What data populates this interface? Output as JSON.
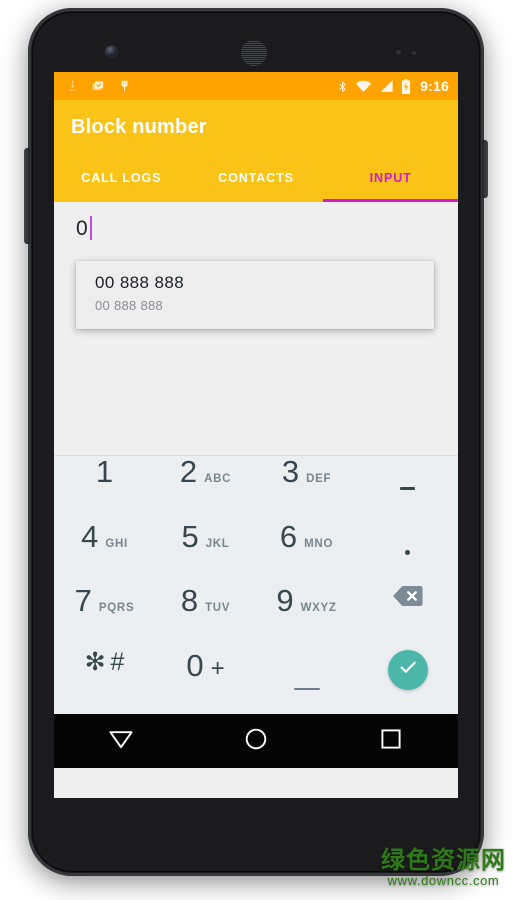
{
  "status_bar": {
    "clock": "9:16",
    "left_icons": [
      "usb-download-icon",
      "screenshot-saved-icon",
      "android-debug-icon"
    ],
    "right_icons": [
      "bluetooth-icon",
      "wifi-icon",
      "cellular-signal-icon",
      "battery-charging-icon"
    ],
    "background_color": "#FFA300"
  },
  "app_bar": {
    "title": "Block number",
    "background_color": "#F9C318",
    "title_color": "#FFFFFF"
  },
  "tabs": {
    "items": [
      {
        "label": "CALL LOGS",
        "selected": false
      },
      {
        "label": "CONTACTS",
        "selected": false
      },
      {
        "label": "INPUT",
        "selected": true
      }
    ],
    "indicator_color": "#D21AD2",
    "selected_text_color": "#D21AD2"
  },
  "input_area": {
    "value": "0",
    "cursor_color": "#C148E0",
    "background_color": "#EFEFEF"
  },
  "suggestions": {
    "items": [
      {
        "primary": "00 888 888",
        "secondary": "00 888 888"
      }
    ],
    "background_color": "#EEEEEE"
  },
  "keypad": {
    "background_color": "#ECEFF1",
    "keys": [
      {
        "digit": "1",
        "letters": "",
        "type": "digit"
      },
      {
        "digit": "2",
        "letters": "ABC",
        "type": "digit"
      },
      {
        "digit": "3",
        "letters": "DEF",
        "type": "digit"
      },
      {
        "digit": "",
        "letters": "",
        "type": "dash",
        "name": "dash-key"
      },
      {
        "digit": "4",
        "letters": "GHI",
        "type": "digit"
      },
      {
        "digit": "5",
        "letters": "JKL",
        "type": "digit"
      },
      {
        "digit": "6",
        "letters": "MNO",
        "type": "digit"
      },
      {
        "digit": "",
        "letters": "",
        "type": "dot",
        "name": "dot-key"
      },
      {
        "digit": "7",
        "letters": "PQRS",
        "type": "digit"
      },
      {
        "digit": "8",
        "letters": "TUV",
        "type": "digit"
      },
      {
        "digit": "9",
        "letters": "WXYZ",
        "type": "digit"
      },
      {
        "digit": "",
        "letters": "",
        "type": "backspace",
        "name": "backspace-key"
      },
      {
        "digit": "",
        "letters": "",
        "type": "starhash",
        "name": "star-hash-key",
        "star": "✻",
        "hash": "#"
      },
      {
        "digit": "0",
        "letters": "",
        "type": "zeroplus",
        "plus": "+"
      },
      {
        "digit": "",
        "letters": "",
        "type": "underscore",
        "name": "space-key"
      },
      {
        "digit": "",
        "letters": "",
        "type": "fab",
        "name": "confirm-fab"
      }
    ],
    "digit_color": "#37474F",
    "letters_color": "#78868F",
    "fab_color": "#4CB6AB"
  },
  "nav_bar": {
    "buttons": [
      "back-triangle-icon",
      "home-circle-icon",
      "recents-square-icon"
    ],
    "background_color": "#050505"
  },
  "watermark": {
    "site_name_cn": "绿色资源网",
    "url": "www.downcc.com",
    "color": "#2F7A18"
  }
}
